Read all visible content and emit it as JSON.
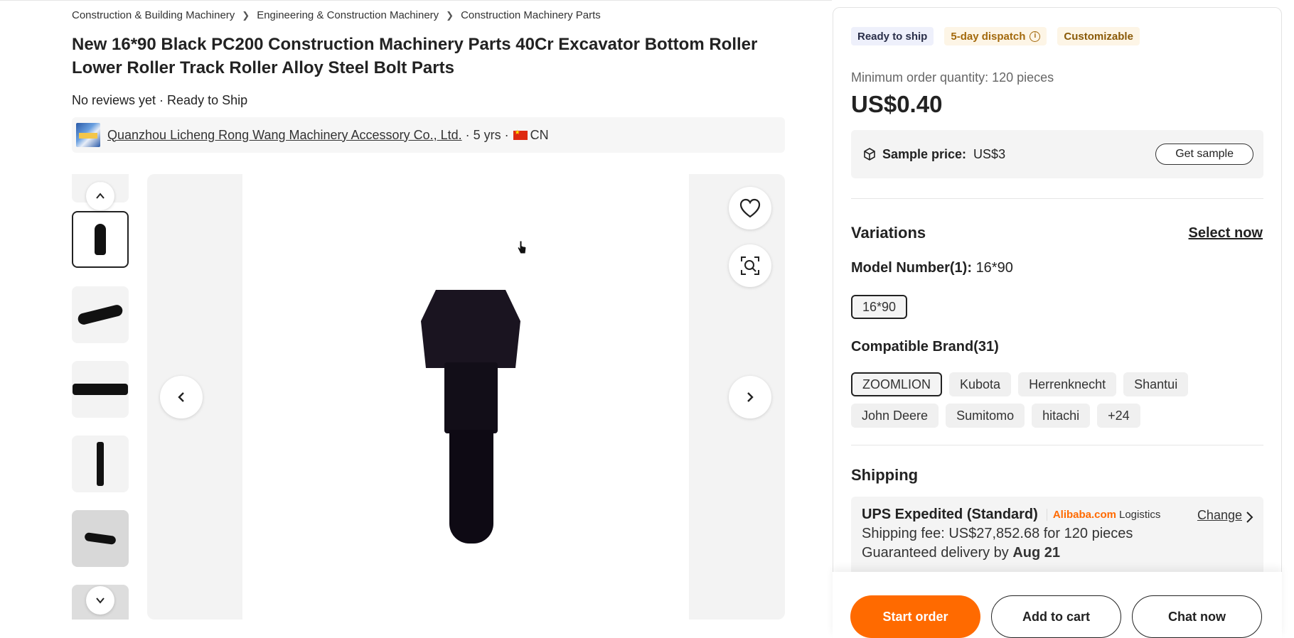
{
  "breadcrumb": [
    "Construction & Building Machinery",
    "Engineering & Construction Machinery",
    "Construction Machinery Parts"
  ],
  "product": {
    "title": "New 16*90 Black PC200 Construction Machinery Parts 40Cr Excavator Bottom Roller Lower Roller Track Roller Alloy Steel Bolt Parts",
    "reviews": "No reviews yet · Ready to Ship"
  },
  "supplier": {
    "name": "Quanzhou Licheng Rong Wang Machinery Accessory Co., Ltd.",
    "years": "· 5 yrs ·",
    "country": "CN"
  },
  "badges": {
    "ready": "Ready to ship",
    "dispatch": "5-day dispatch",
    "customizable": "Customizable"
  },
  "pricing": {
    "moq": "Minimum order quantity: 120 pieces",
    "price": "US$0.40",
    "sample_label": "Sample price:",
    "sample_price": "US$3",
    "get_sample": "Get sample"
  },
  "variations": {
    "heading": "Variations",
    "select_now": "Select now",
    "model_label": "Model Number(1):",
    "model_value": "16*90",
    "models": [
      "16*90"
    ],
    "brand_label": "Compatible Brand(31)",
    "brands": [
      "ZOOMLION",
      "Kubota",
      "Herrenknecht",
      "Shantui",
      "John Deere",
      "Sumitomo",
      "hitachi",
      "+24"
    ]
  },
  "shipping": {
    "heading": "Shipping",
    "method": "UPS Expedited (Standard)",
    "brand": "Alibaba.com",
    "logistics": "Logistics",
    "change": "Change",
    "fee": "Shipping fee: US$27,852.68 for 120 pieces",
    "delivery_prefix": "Guaranteed delivery by",
    "delivery_date": "Aug 21"
  },
  "actions": {
    "start": "Start order",
    "cart": "Add to cart",
    "chat": "Chat now"
  },
  "colors": {
    "accent": "#ff6a00",
    "badge_ready_bg": "#eef0fb",
    "badge_dispatch_bg": "#fdf5e6"
  },
  "icons": {
    "favorite": "heart-icon",
    "image_search": "image-search-icon",
    "prev": "chevron-left-icon",
    "next": "chevron-right-icon",
    "sample": "box-icon"
  }
}
